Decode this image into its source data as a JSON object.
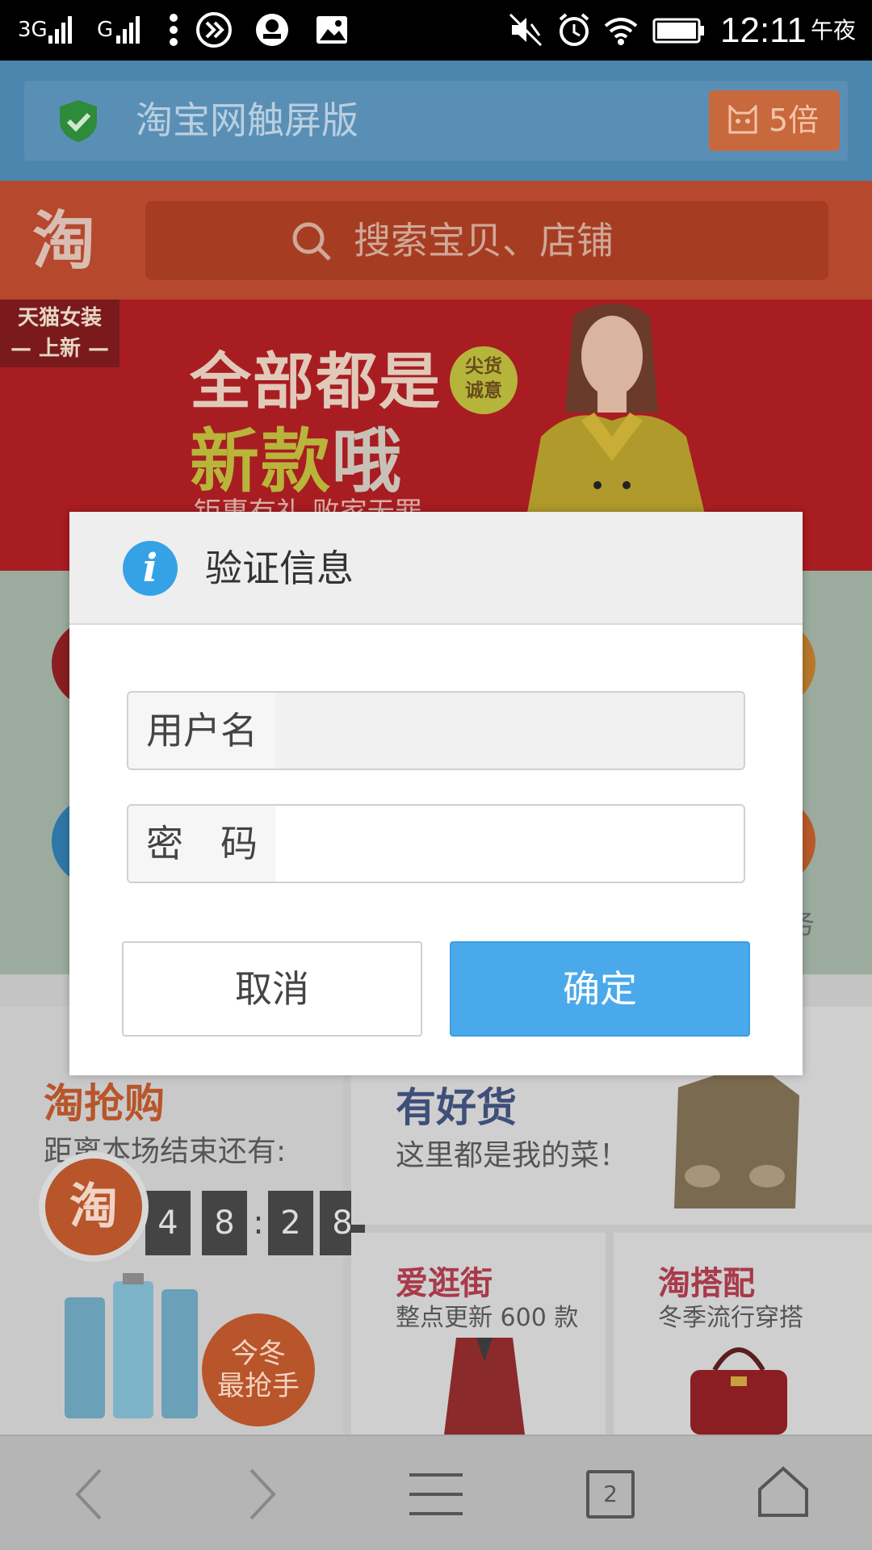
{
  "status_bar": {
    "network_1": "3G",
    "network_2": "G",
    "time": "12:11",
    "period": "午夜"
  },
  "browser": {
    "page_title": "淘宝网触屏版",
    "x5_label": "5倍"
  },
  "taobao": {
    "logo": "淘",
    "search_placeholder": "搜索宝贝、店铺"
  },
  "banner": {
    "tag_line1": "天猫女装",
    "tag_line2": "— 上新 —",
    "headline1": "全部都是",
    "headline2_a": "新款",
    "headline2_b": "哦",
    "badge_line1": "尖货",
    "badge_line2": "诚意",
    "subline": "钜惠有礼 败家无罪"
  },
  "sections": {
    "qiang_title": "淘抢购",
    "qiang_sub": "距离本场结束还有:",
    "countdown": [
      "4",
      "8",
      ":",
      "2",
      "8"
    ],
    "promo_line1": "今冬",
    "promo_line2": "最抢手",
    "haohuo_title": "有好货",
    "haohuo_sub": "这里都是我的菜！",
    "guangjie_title": "爱逛街",
    "guangjie_sub": "整点更新 600 款",
    "dapei_title": "淘搭配",
    "dapei_sub": "冬季流行穿搭",
    "side_char": "务",
    "float_logo": "淘"
  },
  "dialog": {
    "title": "验证信息",
    "username_label": "用户名",
    "username_value": "",
    "password_label": "密　码",
    "password_value": "",
    "cancel_label": "取消",
    "confirm_label": "确定"
  },
  "bottom_nav": {
    "tab_count": "2"
  },
  "colors": {
    "accent": "#4aa9ea",
    "taobao_orange": "#b5482d",
    "url_bar": "#4a86ad"
  }
}
